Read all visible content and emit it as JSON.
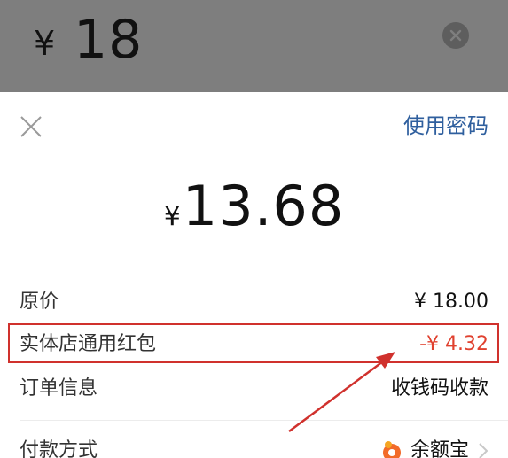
{
  "background": {
    "currency": "¥",
    "amount": "18"
  },
  "header": {
    "password_label": "使用密码"
  },
  "payment": {
    "currency": "¥",
    "amount": "13.68"
  },
  "details": {
    "original": {
      "label": "原价",
      "value": "¥ 18.00"
    },
    "red_packet": {
      "label": "实体店通用红包",
      "value": "-¥ 4.32"
    },
    "order": {
      "label": "订单信息",
      "value": "收钱码收款"
    },
    "method": {
      "label": "付款方式",
      "value": "余额宝"
    }
  },
  "icons": {
    "close": "close-icon",
    "clear": "clear-icon",
    "yuebao": "yuebao-icon",
    "chevron": "chevron-right-icon"
  },
  "colors": {
    "link": "#2f5f9e",
    "discount": "#e0412f",
    "annotation": "#d0312d"
  }
}
